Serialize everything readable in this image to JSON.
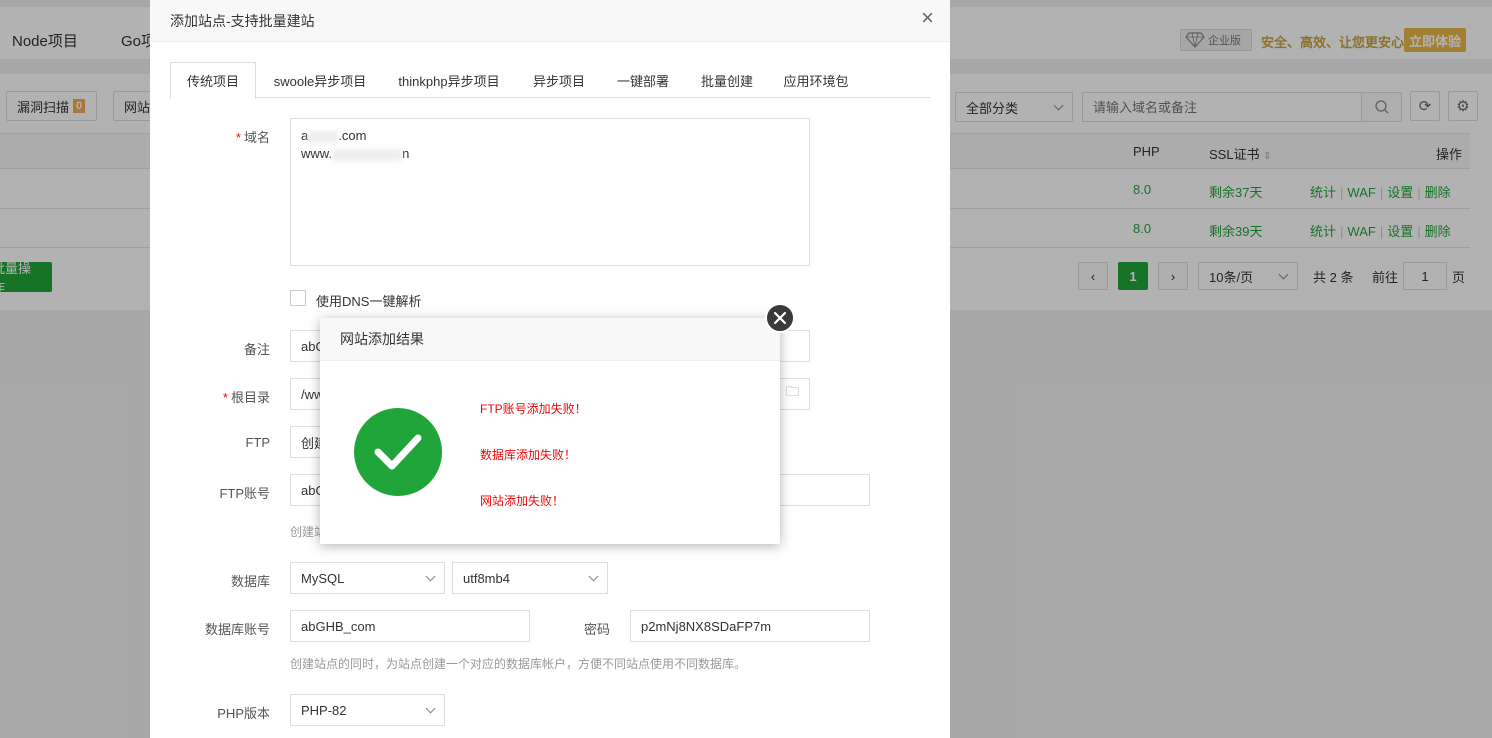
{
  "topnav": {
    "tabs": [
      "Node项目",
      "Go项"
    ],
    "enterprise_label": "企业版",
    "enterprise_slogan": "安全、高效、让您更安心",
    "try_button": "立即体验"
  },
  "toolbar": {
    "vuln_scan_label": "漏洞扫描",
    "vuln_count": "0",
    "site_btn_label": "网站",
    "category_select": "全部分类",
    "search_placeholder": "请输入域名或备注"
  },
  "table": {
    "headers": {
      "php": "PHP",
      "ssl": "SSL证书",
      "ops": "操作"
    },
    "rows": [
      {
        "php": "8.0",
        "ssl": "剩余37天",
        "ops": [
          "统计",
          "WAF",
          "设置",
          "删除"
        ]
      },
      {
        "php": "8.0",
        "ssl": "剩余39天",
        "ops": [
          "统计",
          "WAF",
          "设置",
          "删除"
        ]
      }
    ]
  },
  "footer": {
    "batch_label": "批量操作",
    "current_page": "1",
    "page_size": "10条/页",
    "total": "共 2 条",
    "goto_label": "前往",
    "goto_value": "1",
    "page_unit": "页"
  },
  "site_modal": {
    "title": "添加站点-支持批量建站",
    "tabs": [
      "传统项目",
      "swoole异步项目",
      "thinkphp异步项目",
      "异步项目",
      "一键部署",
      "批量创建",
      "应用环境包"
    ],
    "domain_label": "域名",
    "domain_line1_prefix": "a",
    "domain_line1_suffix": ".com",
    "domain_line2_prefix": "www.",
    "domain_line2_suffix": "n",
    "dns_label": "使用DNS一键解析",
    "remark_label": "备注",
    "remark_value": "abG",
    "root_label": "根目录",
    "root_value": "/ww",
    "ftp_label": "FTP",
    "ftp_value": "创建",
    "ftp_account_label": "FTP账号",
    "ftp_account_value": "abG",
    "ftp_hint": "创建站",
    "db_label": "数据库",
    "db_type": "MySQL",
    "db_charset": "utf8mb4",
    "db_account_label": "数据库账号",
    "db_account_value": "abGHB_com",
    "db_password_label": "密码",
    "db_password_value": "p2mNj8NX8SDaFP7m",
    "db_hint": "创建站点的同时，为站点创建一个对应的数据库帐户，方便不同站点使用不同数据库。",
    "php_label": "PHP版本",
    "php_value": "PHP-82"
  },
  "result_dialog": {
    "title": "网站添加结果",
    "messages": [
      "FTP账号添加失败！",
      "数据库添加失败！",
      "网站添加失败！"
    ]
  },
  "colors": {
    "brand_green": "#20a53a",
    "error_red": "#ef0808",
    "gold": "#c9a243"
  }
}
